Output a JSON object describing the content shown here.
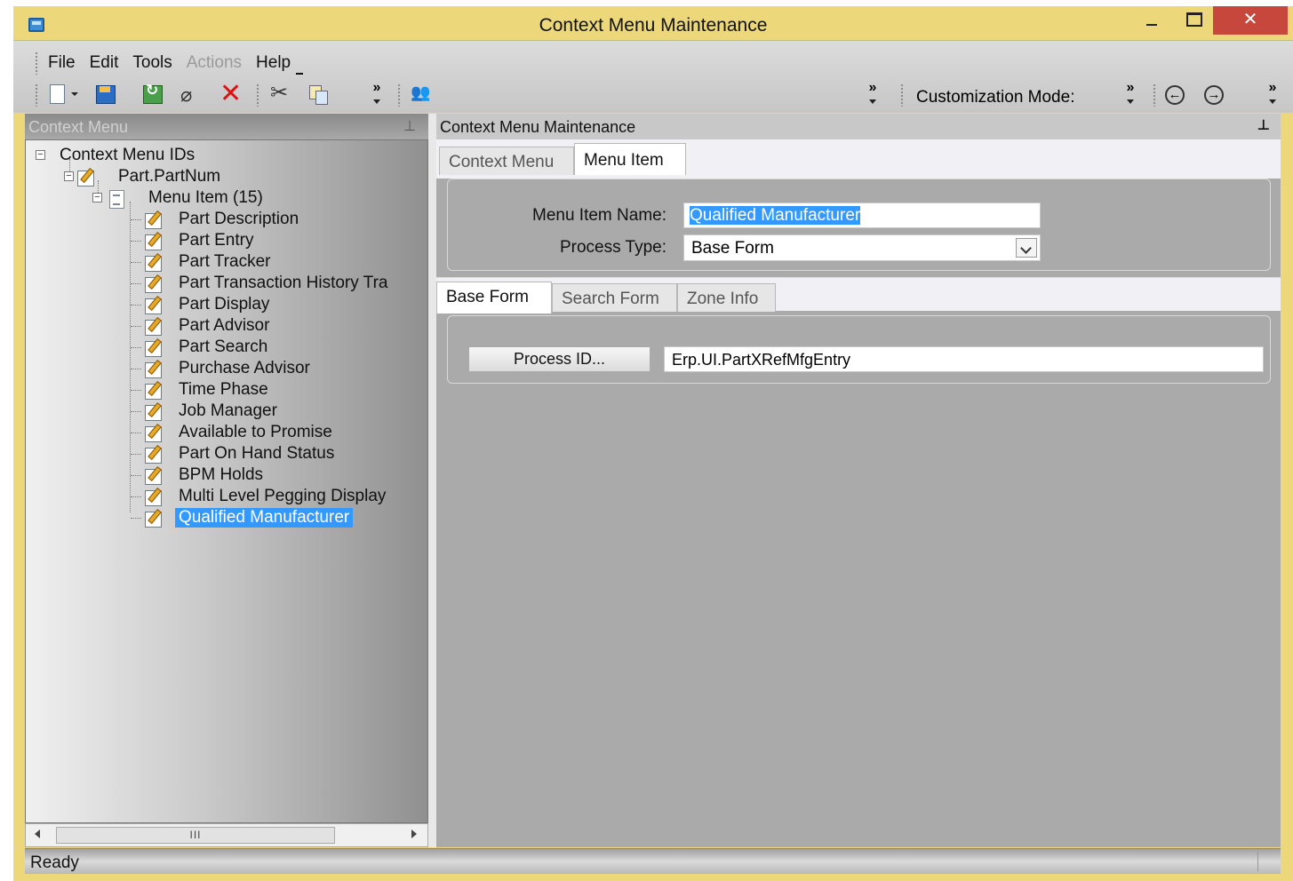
{
  "window": {
    "title": "Context Menu Maintenance",
    "close_glyph": "✕"
  },
  "menubar": {
    "items": [
      "File",
      "Edit",
      "Tools",
      "Actions",
      "Help"
    ]
  },
  "toolbar": {
    "customization_label": "Customization Mode:",
    "chevron": "»",
    "back_glyph": "←",
    "forward_glyph": "→",
    "eraser_glyph": "⌀",
    "delete_glyph": "✕",
    "cut_glyph": "✂",
    "find_glyph": "👥"
  },
  "left_pane": {
    "title": "Context Menu",
    "pin_glyph": "⊥",
    "tree": {
      "root": "Context Menu IDs",
      "context_id": "Part.PartNum",
      "group": "Menu Item (15)",
      "items": [
        "Part Description",
        "Part Entry",
        "Part Tracker",
        "Part Transaction History Tra",
        "Part Display",
        "Part Advisor",
        "Part Search",
        "Purchase Advisor",
        "Time Phase",
        "Job Manager",
        "Available to Promise",
        "Part On Hand Status",
        "BPM Holds",
        "Multi Level Pegging Display",
        "Qualified Manufacturer"
      ]
    },
    "scroll_thumb": "III"
  },
  "right_pane": {
    "title": "Context Menu Maintenance",
    "pin_glyph": "⊥",
    "tabs": [
      "Context Menu",
      "Menu Item"
    ],
    "menu_item_name_label": "Menu Item Name:",
    "menu_item_name_value": "Qualified Manufacturer",
    "process_type_label": "Process Type:",
    "process_type_value": "Base Form",
    "sub_tabs": [
      "Base Form",
      "Search Form",
      "Zone Info"
    ],
    "process_id_button": "Process ID...",
    "process_id_value": "Erp.UI.PartXRefMfgEntry"
  },
  "status": {
    "text": "Ready"
  },
  "colors": {
    "title_bar": "#ecd77a",
    "close_button": "#c7473c",
    "selection": "#3399ff"
  }
}
